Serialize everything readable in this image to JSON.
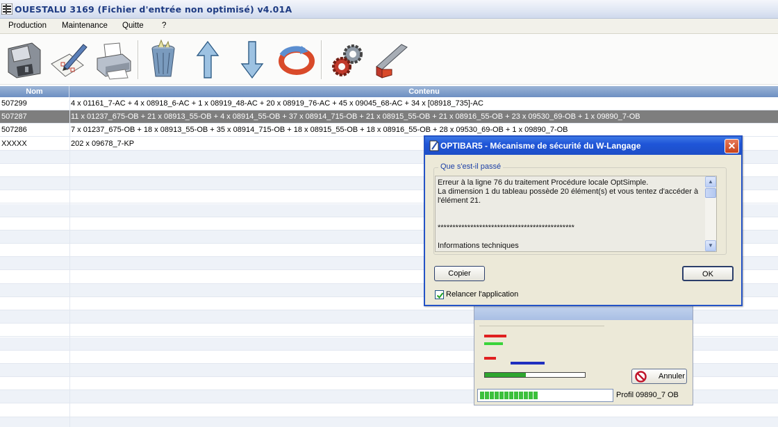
{
  "window": {
    "title": "OUESTALU 3169 (Fichier d'entrée non optimisé) v4.01A"
  },
  "menu": [
    "Production",
    "Maintenance",
    "Quitte",
    "?"
  ],
  "toolbar": {
    "buttons": [
      "floppy-disk-icon",
      "checklist-pen-icon",
      "printer-icon",
      "trash-can-icon",
      "arrow-up-icon",
      "arrow-down-icon",
      "refresh-icon",
      "gears-icon",
      "profile-cut-icon"
    ]
  },
  "table": {
    "columns": [
      "Nom",
      "Contenu"
    ],
    "rows": [
      {
        "nom": "507299",
        "contenu": "4 x 01161_7-AC  +  4 x 08918_6-AC  +  1 x 08919_48-AC  +  20 x 08919_76-AC  +  45 x 09045_68-AC  +  34 x [08918_735]-AC",
        "state": "normal"
      },
      {
        "nom": "507287",
        "contenu": "11 x 01237_675-OB  +  21 x 08913_55-OB  +  4 x 08914_55-OB  +  37 x 08914_715-OB  +  21 x 08915_55-OB  +  21 x 08916_55-OB  +  23 x 09530_69-OB  +  1 x 09890_7-OB",
        "state": "selected"
      },
      {
        "nom": "507286",
        "contenu": "7 x 01237_675-OB  +  18 x 08913_55-OB  +  35 x 08914_715-OB  +  18 x 08915_55-OB  +  18 x 08916_55-OB  +  28 x 09530_69-OB  +  1 x 09890_7-OB",
        "state": "normal"
      },
      {
        "nom": "XXXXX",
        "contenu": "202 x 09678_7-KP",
        "state": "normal"
      }
    ]
  },
  "dialog": {
    "title": "OPTIBAR5 - Mécanisme de sécurité du W-Langage",
    "group_label": "Que s'est-il passé",
    "message_lines": [
      "Erreur à la ligne 76 du traitement Procédure locale OptSimple.",
      "La dimension 1 du tableau possède 20 élément(s) et vous tentez d'accéder à",
      "l'élément 21.",
      "",
      "",
      "**********************************************",
      "",
      "Informations techniques"
    ],
    "copy_button": "Copier",
    "ok_button": "OK",
    "restart_checkbox_label": "Relancer l'application",
    "restart_checked": true
  },
  "progress_window": {
    "cancel_button": "Annuler",
    "profile_label": "Profil 09890_7 OB",
    "progress_fraction": 0.41,
    "segments_filled": 12
  },
  "colors": {
    "selected_row": "#7e7e7e",
    "header_blue": "#6d8fc2",
    "dialog_title_blue": "#1f55d8",
    "progress_green": "#2fa52f"
  }
}
